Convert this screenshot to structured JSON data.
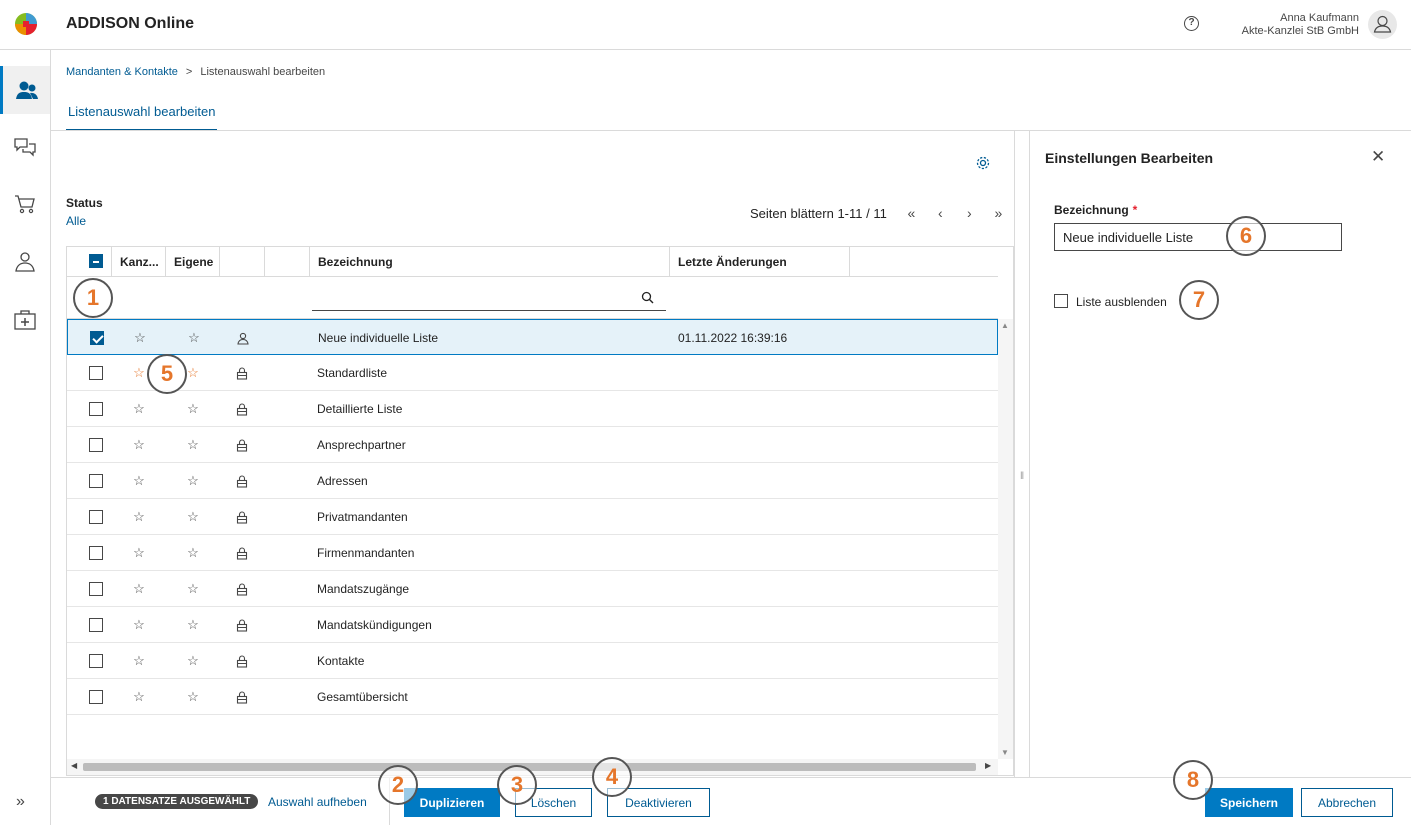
{
  "header": {
    "app_title": "ADDISON Online",
    "help_label": "?",
    "user_name": "Anna Kaufmann",
    "user_company": "Akte-Kanzlei StB GmbH"
  },
  "breadcrumb": {
    "link": "Mandanten & Kontakte",
    "separator": ">",
    "current": "Listenauswahl bearbeiten"
  },
  "tabs": [
    "Listenauswahl bearbeiten"
  ],
  "status": {
    "label": "Status",
    "value": "Alle"
  },
  "pager": {
    "text": "Seiten blättern 1-11 / 11",
    "first": "«",
    "prev": "‹",
    "next": "›",
    "last": "»"
  },
  "table": {
    "columns": [
      "Kanz...",
      "Eigene",
      "",
      "",
      "Bezeichnung",
      "Letzte Änderungen",
      ""
    ],
    "rows": [
      {
        "name": "Neue individuelle Liste",
        "changed": "01.11.2022 16:39:16",
        "checked": true,
        "icon": "person-icon"
      },
      {
        "name": "Standardliste",
        "changed": "",
        "checked": false,
        "icon": "lock-icon"
      },
      {
        "name": "Detaillierte Liste",
        "changed": "",
        "checked": false,
        "icon": "lock-icon"
      },
      {
        "name": "Ansprechpartner",
        "changed": "",
        "checked": false,
        "icon": "lock-icon"
      },
      {
        "name": "Adressen",
        "changed": "",
        "checked": false,
        "icon": "lock-icon"
      },
      {
        "name": "Privatmandanten",
        "changed": "",
        "checked": false,
        "icon": "lock-icon"
      },
      {
        "name": "Firmenmandanten",
        "changed": "",
        "checked": false,
        "icon": "lock-icon"
      },
      {
        "name": "Mandatszugänge",
        "changed": "",
        "checked": false,
        "icon": "lock-icon"
      },
      {
        "name": "Mandatskündigungen",
        "changed": "",
        "checked": false,
        "icon": "lock-icon"
      },
      {
        "name": "Kontakte",
        "changed": "",
        "checked": false,
        "icon": "lock-icon"
      },
      {
        "name": "Gesamtübersicht",
        "changed": "",
        "checked": false,
        "icon": "lock-icon"
      }
    ]
  },
  "side_panel": {
    "title": "Einstellungen Bearbeiten",
    "close": "✕",
    "field_label": "Bezeichnung",
    "required_mark": "*",
    "field_value": "Neue individuelle Liste",
    "checkbox_label": "Liste ausblenden"
  },
  "footer": {
    "badge": "1 DATENSATZE AUSGEWÄHLT",
    "deselect": "Auswahl aufheben",
    "duplicate": "Duplizieren",
    "delete": "Löschen",
    "deactivate": "Deaktivieren",
    "save": "Speichern",
    "cancel": "Abbrechen",
    "expand": "»"
  },
  "callouts": [
    "1",
    "2",
    "3",
    "4",
    "5",
    "6",
    "7",
    "8"
  ],
  "colors": {
    "accent": "#007ac3",
    "dark_blue": "#005b92",
    "orange": "#e5762b"
  }
}
